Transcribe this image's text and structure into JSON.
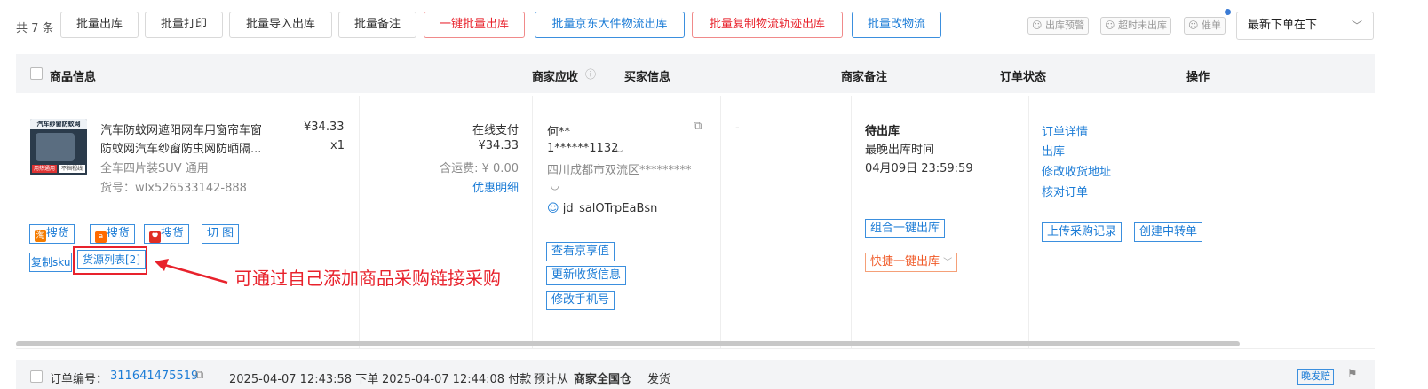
{
  "toolbar": {
    "count": "共 7 条",
    "buttons": [
      "批量出库",
      "批量打印",
      "批量导入出库",
      "批量备注",
      "一键批量出库",
      "批量京东大件物流出库",
      "批量复制物流轨迹出库",
      "批量改物流"
    ],
    "tags": [
      "出库预警",
      "超时未出库",
      "催单"
    ],
    "sort_value": "最新下单在下",
    "accent": "#1c7cd6",
    "danger": "#e8222c"
  },
  "header": {
    "goods": "商品信息",
    "receivable": "商家应收",
    "buyer": "买家信息",
    "remark": "商家备注",
    "status": "订单状态",
    "action": "操作"
  },
  "order": {
    "thumb_text": "汽车纱窗防蚊网",
    "thumb_badge": "不挡视线",
    "thumb_badge2": "用热通用",
    "title_line1": "汽车防蚊网遮阳网车用窗帘车窗",
    "title_line2": "防蚊网汽车纱窗防虫网防晒隔...",
    "price": "¥34.33",
    "qty": "x1",
    "spec": "全车四片装SUV 通用",
    "sku": "货号：wlx526533142-888",
    "search": [
      "搜货",
      "搜货",
      "搜货",
      "切 图"
    ],
    "copy_sku": "复制sku",
    "source_list": "货源列表[2]",
    "annotation": "可通过自己添加商品采购链接采购",
    "pay_method": "在线支付",
    "pay_amount": "¥34.33",
    "shipping": "含运费: ¥ 0.00",
    "discount_link": "优惠明细",
    "buyer_name": "何**",
    "buyer_phone": "1******1132",
    "buyer_addr": "四川成都市双流区*********",
    "buyer_id": "jd_salOTrpEaBsn",
    "buyer_btns": [
      "查看京享值",
      "更新收货信息",
      "修改手机号"
    ],
    "remark": "-",
    "status": "待出库",
    "latest_label": "最晚出库时间",
    "latest_time": "04月09日 23:59:59",
    "status_btns": [
      "组合一键出库",
      "快捷一键出库"
    ],
    "ops": [
      "订单详情",
      "出库",
      "修改收货地址",
      "核对订单"
    ],
    "op_btns": [
      "上传采购记录",
      "创建中转单"
    ]
  },
  "next_order": {
    "label": "订单编号：",
    "number": "311641475519",
    "ordered": "2025-04-07 12:43:58 下单",
    "paid": "2025-04-07 12:44:08 付款",
    "expect_prefix": "预计从",
    "warehouse": "商家全国仓",
    "expect_suffix": "发货",
    "tag": "晚发赔"
  }
}
